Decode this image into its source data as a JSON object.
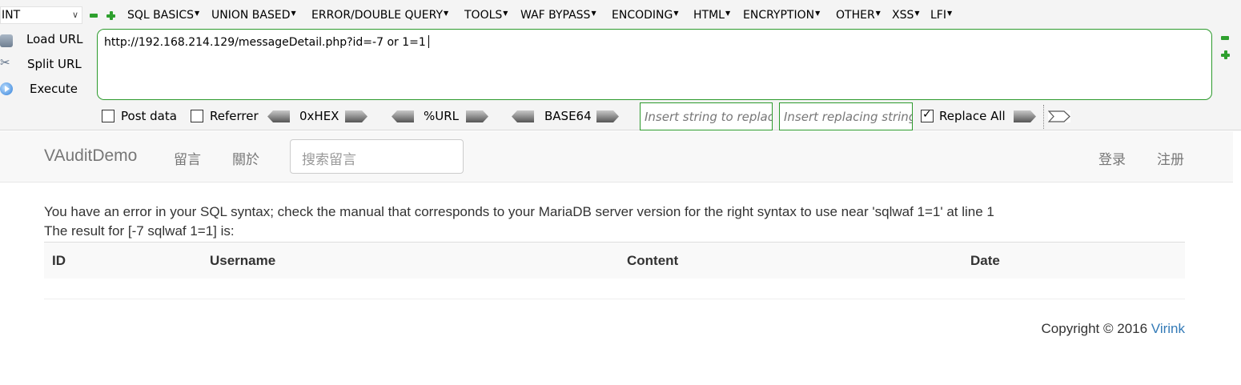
{
  "hackbar": {
    "type_select": "INT",
    "menu": [
      {
        "label": "SQL BASICS"
      },
      {
        "label": "UNION BASED"
      },
      {
        "label": "ERROR/DOUBLE QUERY"
      },
      {
        "label": "TOOLS"
      },
      {
        "label": "WAF BYPASS"
      },
      {
        "label": "ENCODING"
      },
      {
        "label": "HTML"
      },
      {
        "label": "ENCRYPTION"
      },
      {
        "label": "OTHER"
      },
      {
        "label": "XSS"
      },
      {
        "label": "LFI"
      }
    ],
    "actions": {
      "load_url": "Load URL",
      "split_url": "Split URL",
      "execute": "Execute"
    },
    "url": "http://192.168.214.129/messageDetail.php?id=-7 or 1=1",
    "options": {
      "post_data": {
        "label": "Post data",
        "checked": false
      },
      "referrer": {
        "label": "Referrer",
        "checked": false
      },
      "hex": "0xHEX",
      "url_enc": "%URL",
      "base64": "BASE64",
      "replace_from_placeholder": "Insert string to replace",
      "replace_to_placeholder": "Insert replacing string",
      "replace_all": {
        "label": "Replace All",
        "checked": true
      }
    },
    "colors": {
      "accent": "#2c9a2c"
    }
  },
  "site": {
    "brand": "VAuditDemo",
    "nav": {
      "messages": "留言",
      "about": "關於",
      "login": "登录",
      "register": "注册"
    },
    "search_placeholder": "搜索留言",
    "error_message": "You have an error in your SQL syntax; check the manual that corresponds to your MariaDB server version for the right syntax to use near 'sqlwaf 1=1' at line 1",
    "result_text": "The result for [-7 sqlwaf 1=1] is:",
    "table": {
      "columns": [
        "ID",
        "Username",
        "Content",
        "Date"
      ]
    },
    "footer": {
      "copyright": "Copyright © 2016 ",
      "link": "Virink"
    },
    "colors": {
      "link": "#337ab7",
      "text": "#333333",
      "muted": "#777777"
    }
  }
}
